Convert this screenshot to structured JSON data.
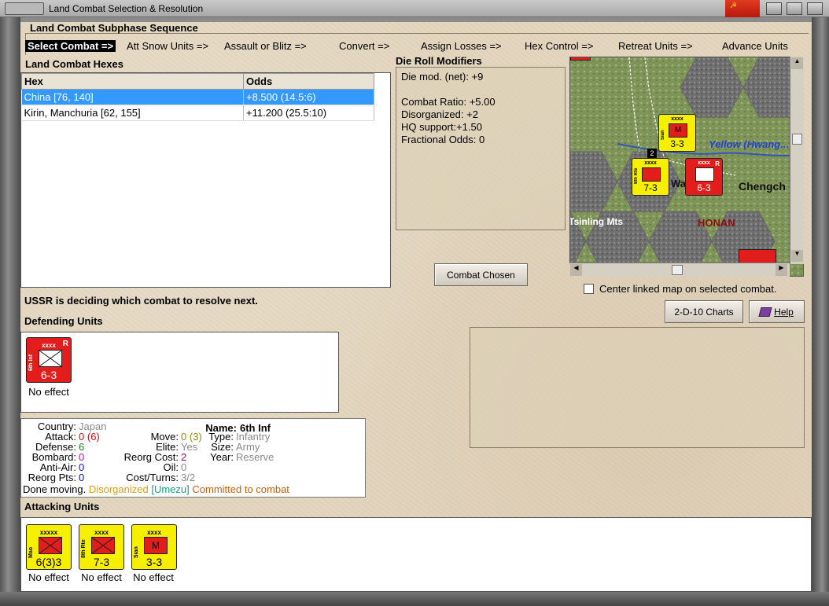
{
  "window": {
    "title": "Land Combat Selection & Resolution"
  },
  "subphase": {
    "title": "Land Combat Subphase Sequence",
    "steps": [
      "Select Combat =>",
      "Att Snow Units =>",
      "Assault or Blitz =>",
      "Convert =>",
      "Assign Losses =>",
      "Hex Control =>",
      "Retreat Units =>",
      "Advance Units"
    ],
    "active_index": 0
  },
  "hexes": {
    "title": "Land Combat Hexes",
    "columns": [
      "Hex",
      "Odds"
    ],
    "rows": [
      {
        "hex": "China [76, 140]",
        "odds": "+8.500 (14.5:6)",
        "selected": true
      },
      {
        "hex": "Kirin, Manchuria [62, 155]",
        "odds": "+11.200 (25.5:10)",
        "selected": false
      }
    ]
  },
  "drm": {
    "title": "Die Roll Modifiers",
    "lines": [
      "Die mod. (net): +9",
      "",
      "Combat Ratio: +5.00",
      "Disorganized: +2",
      "HQ support:+1.50",
      "Fractional Odds: 0"
    ]
  },
  "buttons": {
    "combat_chosen": "Combat Chosen",
    "charts": "2-D-10 Charts",
    "help": "Help"
  },
  "map": {
    "labels": {
      "river": "Yellow (Hwang...",
      "city": "Chengch",
      "region": "HONAN",
      "mountains": "Tsinling Mts",
      "wa": "Wa"
    },
    "counters": [
      {
        "size": "xxxx",
        "name": "Sian",
        "stats": "3-3",
        "color": "yellow",
        "symbol": "M"
      },
      {
        "size": "xxxx",
        "name": "8th Rte",
        "stats": "7-3",
        "color": "yellow",
        "symbol": ""
      },
      {
        "size": "xxxx",
        "name": "6th Inf",
        "stats": "6-3",
        "color": "red",
        "symbol": "",
        "badge": "R"
      }
    ],
    "stack_badge": "2"
  },
  "center_checkbox": {
    "label": "Center linked map on selected combat.",
    "checked": false
  },
  "status": "USSR is deciding which combat to resolve next.",
  "defending": {
    "title": "Defending Units",
    "units": [
      {
        "size": "xxxx",
        "name": "6th Inf",
        "stats": "6-3",
        "badge": "R",
        "result": "No effect"
      }
    ]
  },
  "unit_info": {
    "country_k": "Country:",
    "country": "Japan",
    "name_k": "Name:",
    "name": "6th Inf",
    "attack_k": "Attack:",
    "attack": "0",
    "attack_paren": "(6)",
    "move_k": "Move:",
    "move": "0",
    "move_paren": "(3)",
    "type_k": "Type:",
    "type": "Infantry",
    "defense_k": "Defense:",
    "defense": "6",
    "elite_k": "Elite:",
    "elite": "Yes",
    "size_k": "Size:",
    "size": "Army",
    "bombard_k": "Bombard:",
    "bombard": "0",
    "reorg_cost_k": "Reorg Cost:",
    "reorg_cost": "2",
    "year_k": "Year:",
    "year": "Reserve",
    "antiair_k": "Anti-Air:",
    "antiair": "0",
    "oil_k": "Oil:",
    "oil": "0",
    "reorg_pts_k": "Reorg Pts:",
    "reorg_pts": "0",
    "cost_turns_k": "Cost/Turns:",
    "cost_turns": "3/2",
    "footer_moving": "Done moving.",
    "footer_disorg": "Disorganized",
    "footer_hq": "[Umezu]",
    "footer_committed": "Committed to combat"
  },
  "attacking": {
    "title": "Attacking Units",
    "units": [
      {
        "size": "xxxxx",
        "name": "Mao",
        "stats": "6(3)3",
        "symbol": "",
        "result": "No effect"
      },
      {
        "size": "xxxx",
        "name": "8th Rte",
        "stats": "7-3",
        "symbol": "",
        "result": "No effect"
      },
      {
        "size": "xxxx",
        "name": "Sian",
        "stats": "3-3",
        "symbol": "M",
        "result": "No effect"
      }
    ]
  },
  "colors": {
    "red": "#e31c1c",
    "yellow": "#f7ef00",
    "selection": "#3399ff",
    "disorganized": "#d4a017",
    "hq": "#1a9a8a",
    "committed": "#c06010"
  }
}
